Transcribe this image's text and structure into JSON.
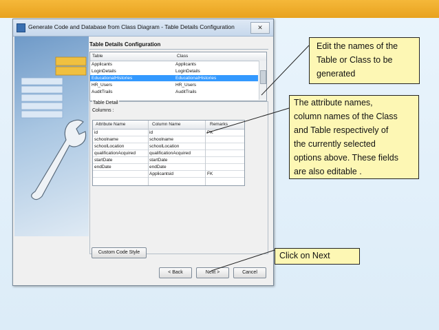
{
  "dialog": {
    "title": "Generate Code and Database from Class Diagram - Table Details Configuration",
    "close_glyph": "✕",
    "heading": "Table Details Configuration",
    "table_list": {
      "headers": [
        "Table",
        "Class"
      ],
      "rows": [
        [
          "Applicants",
          "Applicants"
        ],
        [
          "LoginDetails",
          "LoginDetails"
        ],
        [
          "EducationalHistories",
          "EducationalHistories"
        ],
        [
          "HR_Users",
          "HR_Users"
        ],
        [
          "AuditTrails",
          "AuditTrails"
        ]
      ],
      "selected_index": 2
    },
    "detail_label": "Table Detail",
    "columns_label": "Columns :",
    "columns_table": {
      "headers": [
        "Attribute Name",
        "Column Name",
        "Remarks"
      ],
      "rows": [
        [
          "id",
          "id",
          "PK"
        ],
        [
          "schoolname",
          "schoolname",
          ""
        ],
        [
          "schoolLocation",
          "schoolLocation",
          ""
        ],
        [
          "qualificationAcquired",
          "qualificationAcquired",
          ""
        ],
        [
          "startDate",
          "startDate",
          ""
        ],
        [
          "endDate",
          "endDate",
          ""
        ],
        [
          "",
          "Applicantsid",
          "FK"
        ]
      ]
    },
    "custom_code_style_label": "Custom Code Style",
    "back_label": "< Back",
    "next_label": "Next >",
    "cancel_label": "Cancel"
  },
  "callouts": {
    "names": [
      "Edit the names of the",
      "Table  or Class to be",
      "generated"
    ],
    "attributes": [
      "The attribute names,",
      "column names of the Class",
      "and Table respectively of",
      "the currently selected",
      "options above. These fields",
      "are  also editable ."
    ],
    "next": [
      "Click on Next"
    ]
  },
  "colors": {
    "topbar": "#e8a21e",
    "callout_fill": "#fdf7b4",
    "selection": "#3399ff"
  }
}
